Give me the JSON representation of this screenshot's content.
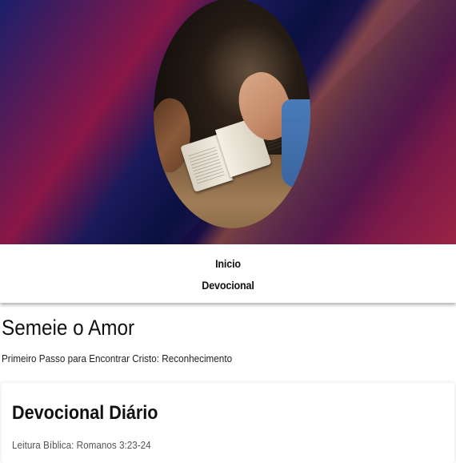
{
  "header": {
    "image_description_icon": "praying-hands-over-bible-image",
    "gradient_colors": [
      "#1b1f6b",
      "#8a1747",
      "#0a1040",
      "#c8274a",
      "#e8343c"
    ]
  },
  "nav": {
    "items": [
      {
        "label": "Inicio"
      },
      {
        "label": "Devocional"
      }
    ]
  },
  "main": {
    "title": "Semeie o Amor",
    "subtitle": "Primeiro Passo para Encontrar Cristo: Reconhecimento"
  },
  "card": {
    "title": "Devocional Diário",
    "reading": "Leitura Bíblica: Romanos 3:23-24"
  }
}
